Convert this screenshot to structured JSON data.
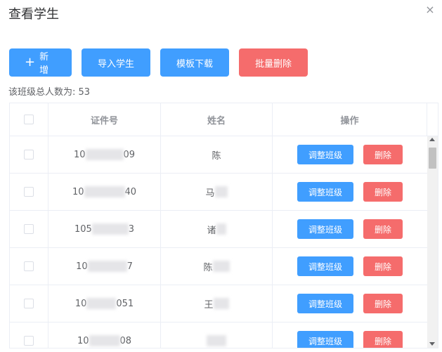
{
  "dialog": {
    "title": "查看学生",
    "close_glyph": "×"
  },
  "toolbar": {
    "add_label": "新增",
    "import_label": "导入学生",
    "template_label": "模板下载",
    "batch_delete_label": "批量删除"
  },
  "summary": {
    "count_text": "该班级总人数为: 53"
  },
  "table": {
    "columns": [
      "证件号",
      "姓名",
      "操作"
    ],
    "rows": [
      {
        "id_visible_start": "10",
        "id_visible_end": "09",
        "name_visible": "陈",
        "adjust_label": "调整班级",
        "delete_label": "删除"
      },
      {
        "id_visible_start": "10",
        "id_visible_end": "40",
        "name_visible": "马",
        "adjust_label": "调整班级",
        "delete_label": "删除"
      },
      {
        "id_visible_start": "105",
        "id_visible_end": "3",
        "name_visible": "诸",
        "adjust_label": "调整班级",
        "delete_label": "删除"
      },
      {
        "id_visible_start": "10",
        "id_visible_end": "7",
        "name_visible": "陈",
        "adjust_label": "调整班级",
        "delete_label": "删除"
      },
      {
        "id_visible_start": "10",
        "id_visible_end": "051",
        "name_visible": "王",
        "adjust_label": "调整班级",
        "delete_label": "删除"
      },
      {
        "id_visible_start": "10",
        "id_visible_end": "08",
        "name_visible": "",
        "adjust_label": "调整班级",
        "delete_label": "删除"
      }
    ]
  },
  "colors": {
    "primary": "#409eff",
    "danger": "#f56c6c",
    "border": "#ebeef5"
  }
}
